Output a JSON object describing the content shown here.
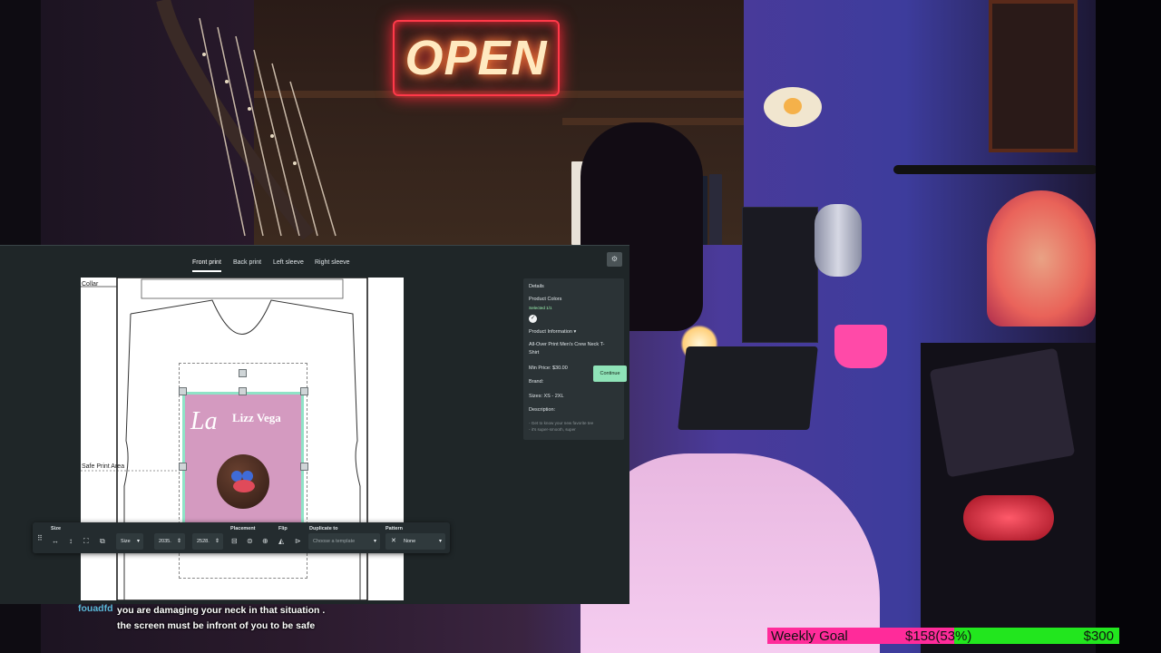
{
  "tabs": {
    "items": [
      {
        "label": "Front print",
        "active": true
      },
      {
        "label": "Back print",
        "active": false
      },
      {
        "label": "Left sleeve",
        "active": false
      },
      {
        "label": "Right sleeve",
        "active": false
      }
    ],
    "help_icon": "gear-icon"
  },
  "canvas": {
    "collar_label": "Collar",
    "safe_area_label": "Safe Print Area",
    "design": {
      "script_text": "La",
      "name_text": "Lizz Vega"
    }
  },
  "toolbar": {
    "size_label": "Size",
    "size_select": "Size",
    "width_value": "2035.",
    "height_value": "2528.",
    "placement_label": "Placement",
    "flip_label": "Flip",
    "duplicate_label": "Duplicate to",
    "duplicate_placeholder": "Choose a template",
    "pattern_label": "Pattern",
    "pattern_value": "None"
  },
  "details": {
    "title": "Details",
    "colors_label": "Product Colors",
    "selected_text": "Selected 1/1",
    "info_label": "Product Information",
    "product_name_line1": "All-Over Print Men's Crew Neck T-",
    "product_name_line2": "Shirt",
    "min_price": "Min Price: $30.00",
    "brand": "Brand:",
    "sizes": "Sizes: XS - 2XL",
    "description": "Description:",
    "desc_line1": "- Get to know your new favorite tee",
    "desc_line2": "- it's super-smooth, super"
  },
  "continue_label": "Continue",
  "chat": {
    "username": "fouadfd",
    "message": "you are damaging your neck in that situation . the screen must be infront of you to be safe"
  },
  "goal": {
    "label": "Weekly Goal",
    "current": "$158(53%)",
    "target": "$300",
    "progress_percent": 53,
    "fill_color": "#ff2b9a",
    "track_color": "#22e61e"
  },
  "scene": {
    "sign_text": "OPEN"
  }
}
